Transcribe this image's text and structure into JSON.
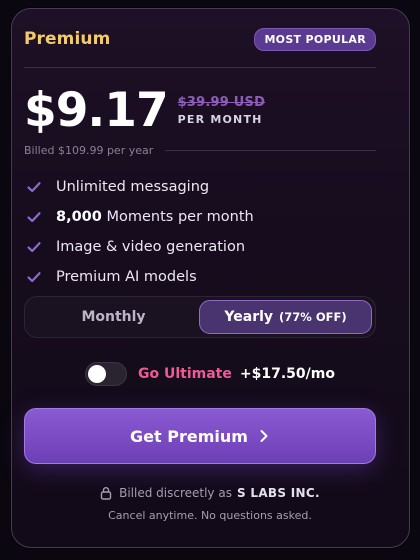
{
  "plan": {
    "name": "Premium",
    "badge": "MOST POPULAR",
    "price": "$9.17",
    "old_price": "$39.99 USD",
    "period": "PER MONTH",
    "billed": "Billed $109.99 per year"
  },
  "features": [
    {
      "bold": "",
      "text": "Unlimited messaging"
    },
    {
      "bold": "8,000",
      "text": " Moments per month"
    },
    {
      "bold": "",
      "text": "Image & video generation"
    },
    {
      "bold": "",
      "text": "Premium AI models"
    }
  ],
  "billing_toggle": {
    "monthly_label": "Monthly",
    "yearly_label": "Yearly",
    "yearly_discount": "(77% OFF)",
    "selected": "Yearly"
  },
  "ultimate": {
    "label": "Go Ultimate",
    "price": "+$17.50/mo",
    "enabled": false
  },
  "cta": {
    "label": "Get Premium"
  },
  "footer": {
    "discreet": "Billed discreetly as",
    "company": "S LABS INC.",
    "cancel": "Cancel anytime. No questions asked."
  },
  "colors": {
    "plan_name": "#f1cc6a",
    "accent_purple": "#7c4dc4",
    "check": "#8b6ad6",
    "ultimate_pink": "#ef5a95"
  },
  "icons": {
    "check": "check-icon",
    "toggle": "toggle-switch",
    "chevron": "chevron-right-icon",
    "lock": "lock-icon"
  }
}
